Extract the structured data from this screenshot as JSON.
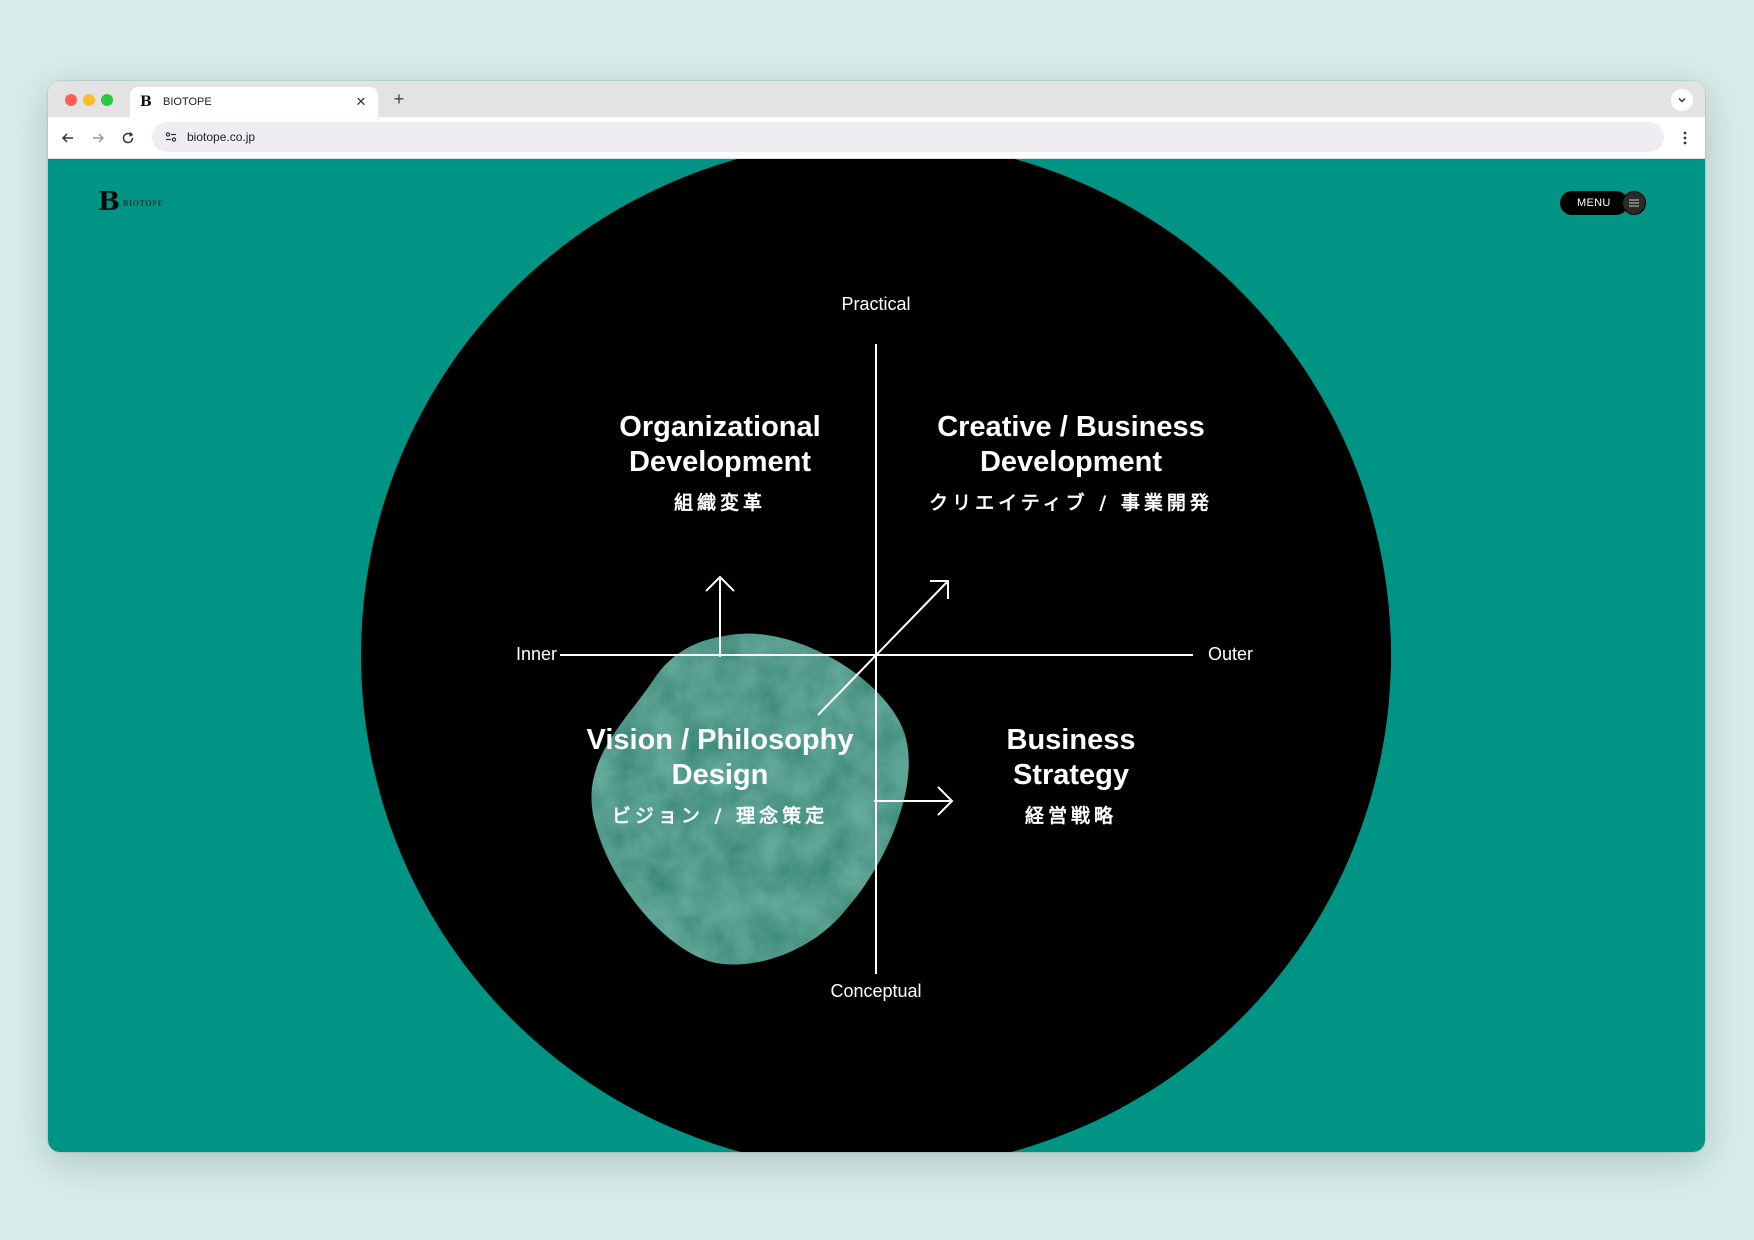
{
  "browser": {
    "tab_title": "BIOTOPE",
    "url": "biotope.co.jp"
  },
  "header": {
    "logo_mark": "B",
    "logo_text": "BIOTOPE",
    "menu_label": "MENU"
  },
  "diagram": {
    "axes": {
      "top": "Practical",
      "bottom": "Conceptual",
      "left": "Inner",
      "right": "Outer"
    },
    "quadrants": {
      "top_left": {
        "title_line1": "Organizational",
        "title_line2": "Development",
        "subtitle": "組織変革"
      },
      "top_right": {
        "title_line1": "Creative / Business",
        "title_line2": "Development",
        "subtitle": "クリエイティブ / 事業開発"
      },
      "bottom_left": {
        "title_line1": "Vision / Philosophy",
        "title_line2": "Design",
        "subtitle": "ビジョン / 理念策定"
      },
      "bottom_right": {
        "title_line1": "Business",
        "title_line2": "Strategy",
        "subtitle": "経営戦略"
      }
    }
  },
  "colors": {
    "page_background": "#009485",
    "circle": "#000000",
    "blob": "#2f7f6d",
    "text": "#ffffff"
  }
}
